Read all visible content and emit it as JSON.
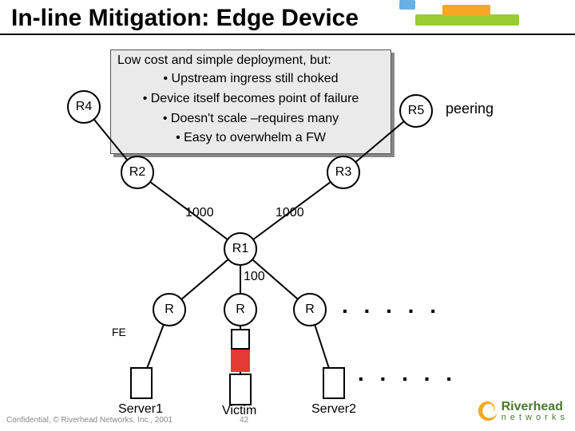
{
  "title": "In-line Mitigation: Edge Device",
  "callout": {
    "lead": "Low cost and simple deployment, but:",
    "b1": "• Upstream ingress still choked",
    "b2": "• Device itself becomes point of failure",
    "b3": "• Doesn't scale –requires many",
    "b4": "• Easy to overwhelm a FW"
  },
  "nodes": {
    "r4": "R4",
    "r5": "R5",
    "r2": "R2",
    "r3": "R3",
    "r1": "R1",
    "rA": "R",
    "rB": "R",
    "rC": "R"
  },
  "labels": {
    "peering": "peering",
    "l1000a": "1000",
    "l1000b": "1000",
    "l100": "100",
    "fe": "FE",
    "srv1": "Server1",
    "victim": "Victim",
    "srv2": "Server2",
    "dots": ". . . . ."
  },
  "logo": {
    "name": "Riverhead",
    "sub": "n e t w o r k s"
  },
  "footer": "Confidential, © Riverhead Networks, Inc., 2001",
  "page": "42"
}
